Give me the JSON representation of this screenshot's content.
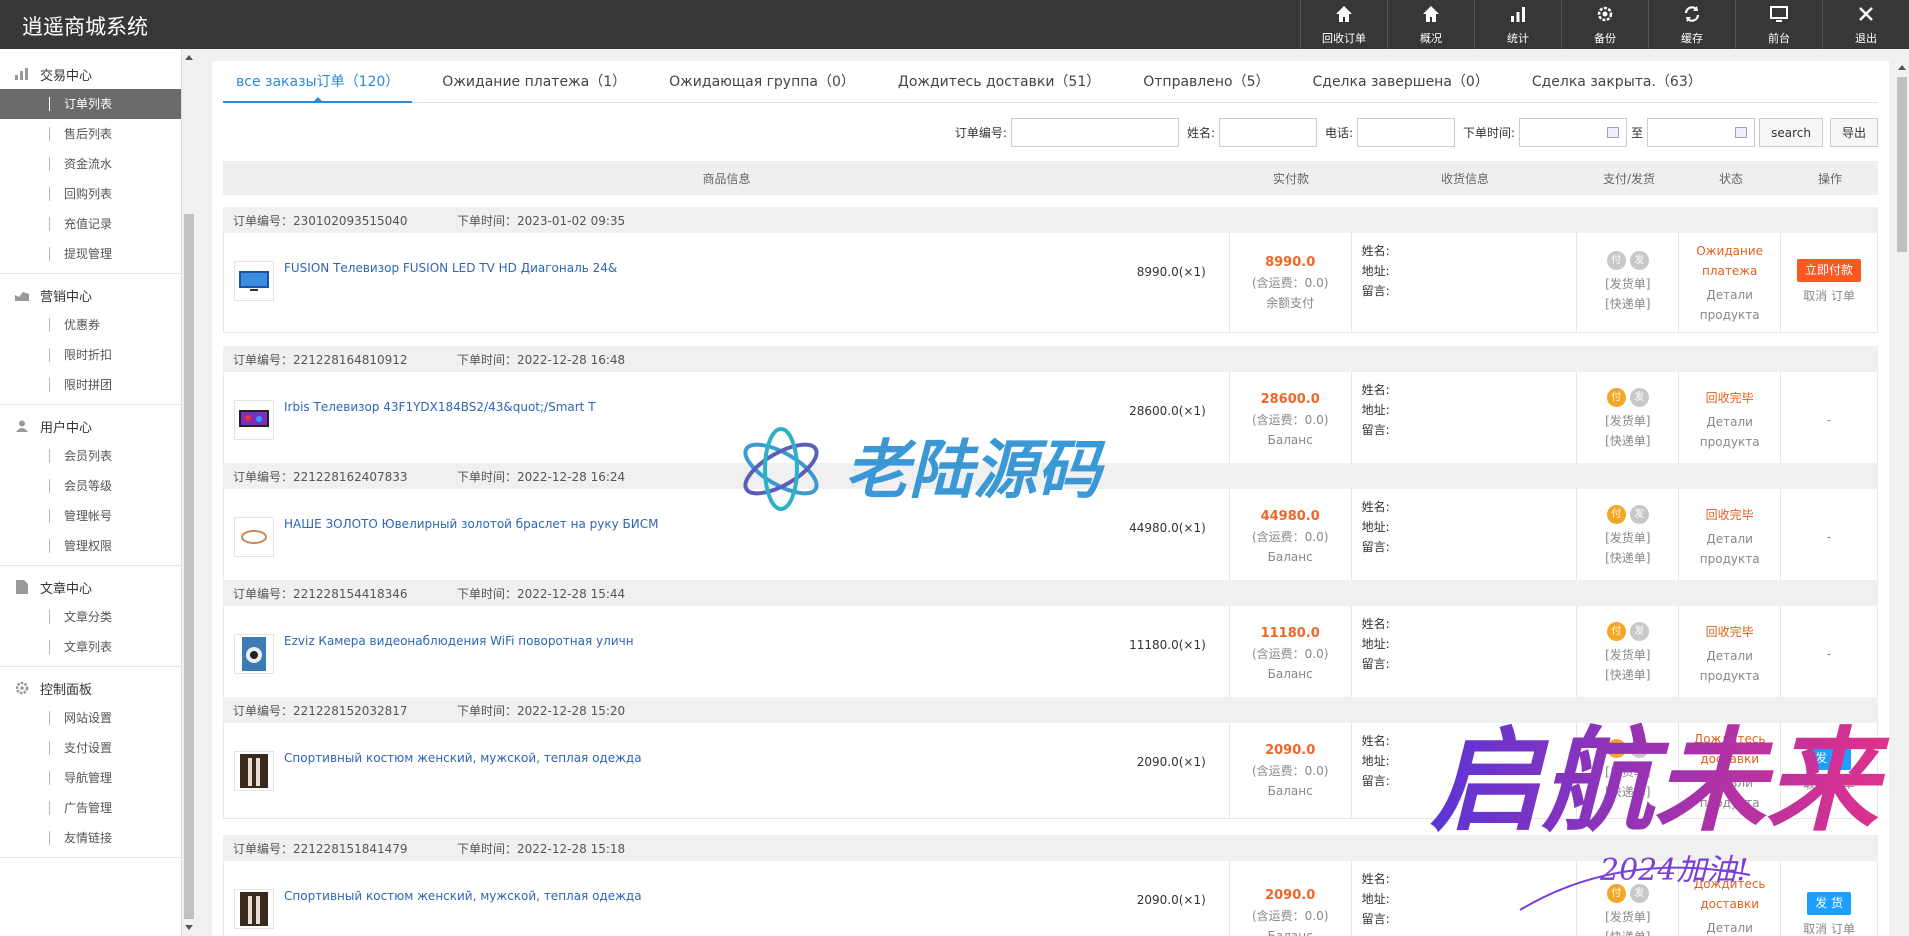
{
  "app": {
    "title": "逍遥商城系统"
  },
  "topnav": [
    {
      "label": "回收订单",
      "icon": "home-icon"
    },
    {
      "label": "概况",
      "icon": "home-icon"
    },
    {
      "label": "统计",
      "icon": "bar-chart-icon"
    },
    {
      "label": "备份",
      "icon": "gear-icon"
    },
    {
      "label": "缓存",
      "icon": "refresh-icon"
    },
    {
      "label": "前台",
      "icon": "monitor-icon"
    },
    {
      "label": "退出",
      "icon": "close-icon"
    }
  ],
  "sidebar": {
    "groups": [
      {
        "title": "交易中心",
        "icon": "bar-chart-icon",
        "items": [
          "订单列表",
          "售后列表",
          "资金流水",
          "回购列表",
          "充值记录",
          "提现管理"
        ]
      },
      {
        "title": "营销中心",
        "icon": "area-chart-icon",
        "items": [
          "优惠券",
          "限时折扣",
          "限时拼团"
        ]
      },
      {
        "title": "用户中心",
        "icon": "user-icon",
        "items": [
          "会员列表",
          "会员等级",
          "管理帐号",
          "管理权限"
        ]
      },
      {
        "title": "文章中心",
        "icon": "document-icon",
        "items": [
          "文章分类",
          "文章列表"
        ]
      },
      {
        "title": "控制面板",
        "icon": "gear-icon",
        "items": [
          "网站设置",
          "支付设置",
          "导航管理",
          "广告管理",
          "友情链接"
        ]
      }
    ],
    "active_item": "订单列表"
  },
  "tabs": [
    {
      "label": "все заказы订单（120）",
      "active": true
    },
    {
      "label": "Ожидание платежа（1）",
      "active": false
    },
    {
      "label": "Ожидающая группа（0）",
      "active": false
    },
    {
      "label": "Дождитесь доставки（51）",
      "active": false
    },
    {
      "label": "Отправлено（5）",
      "active": false
    },
    {
      "label": "Сделка завершена（0）",
      "active": false
    },
    {
      "label": "Сделка закрыта.（63）",
      "active": false
    }
  ],
  "filters": {
    "order_no_label": "订单编号:",
    "name_label": "姓名:",
    "phone_label": "电话:",
    "time_label": "下单时间:",
    "to_label": "至",
    "search_button": "search",
    "export_button": "导出"
  },
  "table_headers": [
    "商品信息",
    "实付款",
    "收货信息",
    "支付/发货",
    "状态",
    "操作"
  ],
  "labels": {
    "order_no_prefix": "订单编号：",
    "order_time_prefix": "下单时间：",
    "freight": "(含运费：0.0)",
    "recv_name": "姓名:",
    "recv_addr": "地址:",
    "recv_msg": "留言:",
    "pay_badge": "付",
    "ship_badge": "发",
    "ship_bill": "[发货单]",
    "express_bill": "[快递单]",
    "detail": "Детали продукта",
    "dash": "-"
  },
  "orders": [
    {
      "order_no": "230102093515040",
      "time": "2023-01-02 09:35",
      "product": "FUSION Телевизор FUSION LED TV HD Диагональ 24&",
      "price_qty": "8990.0(×1)",
      "paid": "8990.0",
      "pay_method": "余额支付",
      "paid_flag": false,
      "status": "Ожидание платежа",
      "status_color": "#e5601b",
      "action": "立即付款",
      "action_style": "red",
      "action2": "取消 订单",
      "thumb": "tv"
    },
    {
      "order_no": "221228164810912",
      "time": "2022-12-28 16:48",
      "product": "Irbis Телевизор 43F1YDX184BS2/43&quot;/Smart T",
      "price_qty": "28600.0(×1)",
      "paid": "28600.0",
      "pay_method": "Баланс",
      "paid_flag": true,
      "status": "回收完毕",
      "status_color": "#e5601b",
      "action": "",
      "action_style": "none",
      "action2": "-",
      "thumb": "tv-purple"
    },
    {
      "order_no": "221228162407833",
      "time": "2022-12-28 16:24",
      "product": "НАШЕ ЗОЛОТО Ювелирный золотой браслет на руку БИСМ",
      "price_qty": "44980.0(×1)",
      "paid": "44980.0",
      "pay_method": "Баланс",
      "paid_flag": true,
      "status": "回收完毕",
      "status_color": "#e5601b",
      "action": "",
      "action_style": "none",
      "action2": "-",
      "thumb": "bracelet"
    },
    {
      "order_no": "221228154418346",
      "time": "2022-12-28 15:44",
      "product": "Ezviz Камера видеонаблюдения WiFi поворотная уличн",
      "price_qty": "11180.0(×1)",
      "paid": "11180.0",
      "pay_method": "Баланс",
      "paid_flag": true,
      "status": "回收完毕",
      "status_color": "#e5601b",
      "action": "",
      "action_style": "none",
      "action2": "-",
      "thumb": "camera"
    },
    {
      "order_no": "221228152032817",
      "time": "2022-12-28 15:20",
      "product": "Спортивный костюм женский, мужской, теплая одежда",
      "price_qty": "2090.0(×1)",
      "paid": "2090.0",
      "pay_method": "Баланс",
      "paid_flag": true,
      "status": "Дождитесь доставки",
      "status_color": "#e5601b",
      "action": "发 货",
      "action_style": "blue",
      "action2": "取消 订单",
      "thumb": "suit"
    },
    {
      "order_no": "221228151841479",
      "time": "2022-12-28 15:18",
      "product": "Спортивный костюм женский, мужской, теплая одежда",
      "price_qty": "2090.0(×1)",
      "paid": "2090.0",
      "pay_method": "Баланс",
      "paid_flag": true,
      "status": "Дождитесь доставки",
      "status_color": "#e5601b",
      "action": "发 货",
      "action_style": "blue",
      "action2": "取消 订单",
      "thumb": "suit"
    }
  ],
  "watermarks": {
    "center": "老陆源码",
    "corner": "启航未来",
    "corner_sub": "2024加油!"
  }
}
